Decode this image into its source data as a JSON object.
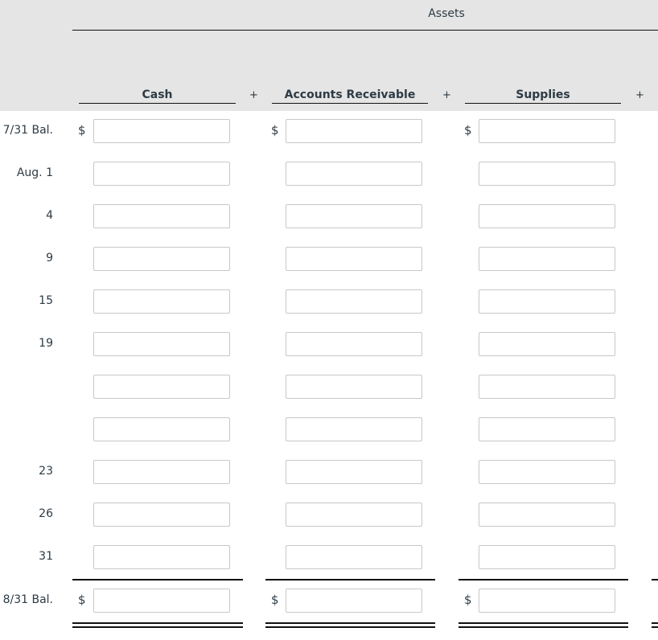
{
  "header": {
    "group_title": "Assets",
    "columns": [
      {
        "label": "Cash",
        "operator": "+"
      },
      {
        "label": "Accounts Receivable",
        "operator": "+"
      },
      {
        "label": "Supplies",
        "operator": "+"
      }
    ]
  },
  "currency_symbol": "$",
  "rows": [
    {
      "label": "7/31 Bal.",
      "show_currency": true,
      "values": [
        "",
        "",
        ""
      ]
    },
    {
      "label": "Aug. 1",
      "show_currency": false,
      "values": [
        "",
        "",
        ""
      ]
    },
    {
      "label": "4",
      "show_currency": false,
      "values": [
        "",
        "",
        ""
      ]
    },
    {
      "label": "9",
      "show_currency": false,
      "values": [
        "",
        "",
        ""
      ]
    },
    {
      "label": "15",
      "show_currency": false,
      "values": [
        "",
        "",
        ""
      ]
    },
    {
      "label": "19",
      "show_currency": false,
      "values": [
        "",
        "",
        ""
      ]
    },
    {
      "label": "",
      "show_currency": false,
      "values": [
        "",
        "",
        ""
      ]
    },
    {
      "label": "",
      "show_currency": false,
      "values": [
        "",
        "",
        ""
      ]
    },
    {
      "label": "23",
      "show_currency": false,
      "values": [
        "",
        "",
        ""
      ]
    },
    {
      "label": "26",
      "show_currency": false,
      "values": [
        "",
        "",
        ""
      ]
    },
    {
      "label": "31",
      "show_currency": false,
      "values": [
        "",
        "",
        ""
      ]
    }
  ],
  "total_row": {
    "label": "8/31 Bal.",
    "show_currency": true,
    "values": [
      "",
      "",
      ""
    ]
  }
}
